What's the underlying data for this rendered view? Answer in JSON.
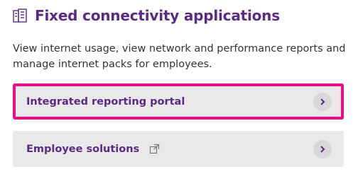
{
  "section": {
    "title": "Fixed connectivity applications",
    "icon": "building-icon",
    "description": "View internet usage, view network and performance reports and manage internet packs for employees."
  },
  "cards": [
    {
      "label": "Integrated reporting portal",
      "icon": "chevron-right-icon",
      "highlighted": true
    },
    {
      "label": "Employee solutions",
      "external_icon": "external-link-icon",
      "icon": "chevron-right-icon",
      "highlighted": false
    }
  ],
  "colors": {
    "accent": "#5b2a86",
    "highlight_border": "#ee0a88",
    "card_background": "#e9e9e9"
  }
}
